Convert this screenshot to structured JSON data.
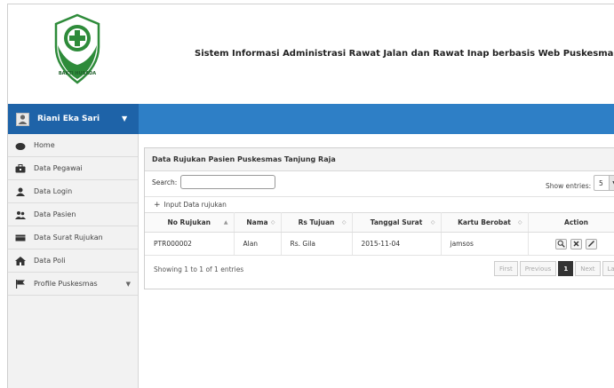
{
  "app": {
    "title": "Sistem Informasi Administrasi Rawat Jalan dan Rawat Inap berbasis Web Puskesmas Tanjung Raja",
    "logo_text": "BAKTI HUSADA"
  },
  "user": {
    "name": "Riani Eka Sari"
  },
  "sidebar": {
    "items": [
      {
        "label": "Home",
        "icon": "home-icon"
      },
      {
        "label": "Data Pegawai",
        "icon": "briefcase-icon"
      },
      {
        "label": "Data Login",
        "icon": "user-icon"
      },
      {
        "label": "Data Pasien",
        "icon": "users-icon"
      },
      {
        "label": "Data Surat Rujukan",
        "icon": "card-icon"
      },
      {
        "label": "Data Poli",
        "icon": "building-icon"
      },
      {
        "label": "Profile Puskesmas",
        "icon": "flag-icon"
      }
    ]
  },
  "panel": {
    "title": "Data Rujukan Pasien Puskesmas Tanjung Raja",
    "search_label": "Search:",
    "search_value": "",
    "show_entries_label": "Show entries:",
    "entries_value": "5",
    "add_label": "Input Data rujukan"
  },
  "table": {
    "headers": [
      "No Rujukan",
      "Nama",
      "Rs Tujuan",
      "Tanggal Surat",
      "Kartu Berobat",
      "Action"
    ],
    "rows": [
      [
        "PTR000002",
        "Alan",
        "Rs. Gila",
        "2015-11-04",
        "jamsos"
      ]
    ]
  },
  "footer": {
    "info": "Showing 1 to 1 of 1 entries",
    "pager": {
      "first": "First",
      "previous": "Previous",
      "current": "1",
      "next": "Next",
      "last": "Last"
    }
  },
  "colors": {
    "topbar": "#2e7fc6",
    "user_block": "#1e63a8",
    "logo_green": "#2e8b3a"
  }
}
